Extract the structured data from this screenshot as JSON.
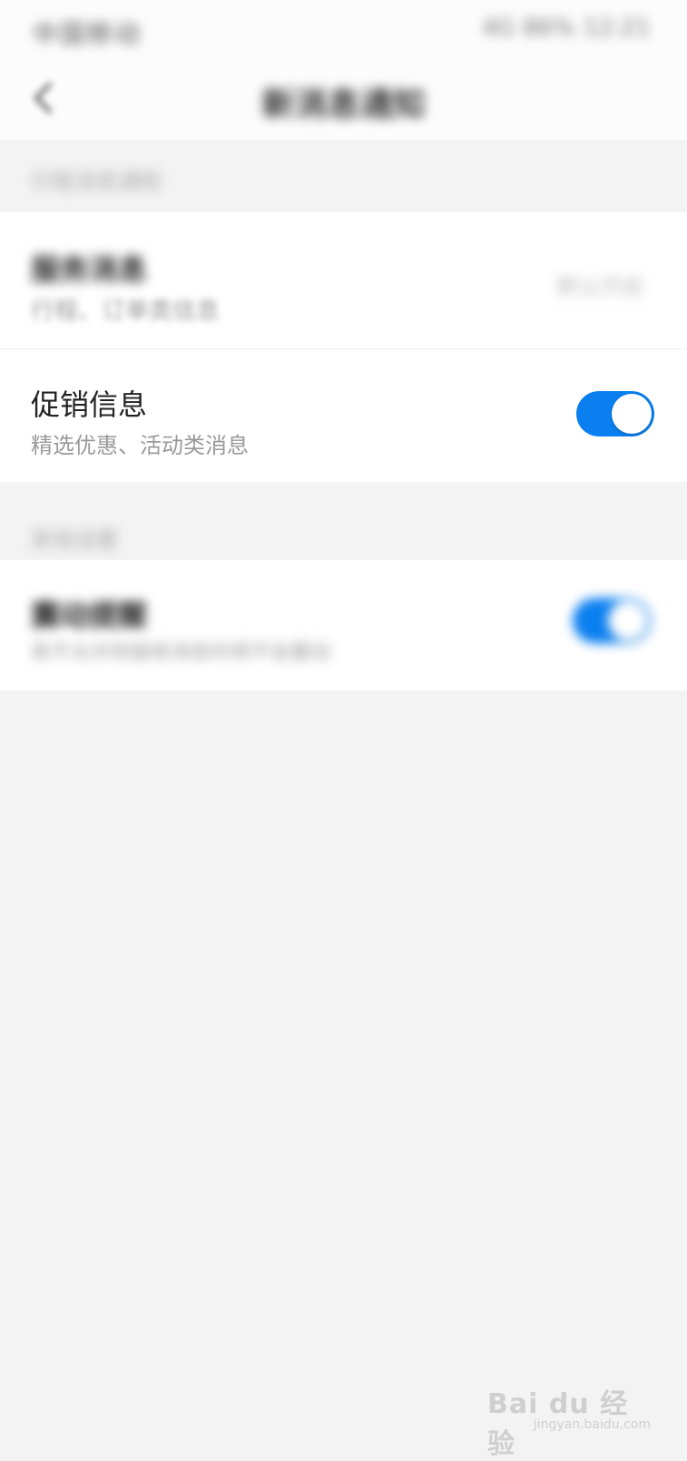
{
  "status_bar": {
    "left_text": "中国移动",
    "right_text": "4G 86% 12:21"
  },
  "nav": {
    "title": "新消息通知"
  },
  "sections": [
    {
      "header": "行程消息通知",
      "rows": [
        {
          "title": "服务消息",
          "subtitle": "行程、订单类信息",
          "value": "默认开启"
        },
        {
          "title": "促销信息",
          "subtitle": "精选优惠、活动类消息",
          "toggle_on": true
        }
      ]
    },
    {
      "header": "其他设置",
      "rows": [
        {
          "title": "震动提醒",
          "subtitle": "若不允许则接收消息时将不会震动",
          "toggle_on": true
        }
      ]
    }
  ],
  "colors": {
    "accent": "#0a7ff0",
    "background": "#f3f3f3"
  },
  "watermark": {
    "logo": "Bai du 经验",
    "url": "jingyan.baidu.com"
  }
}
